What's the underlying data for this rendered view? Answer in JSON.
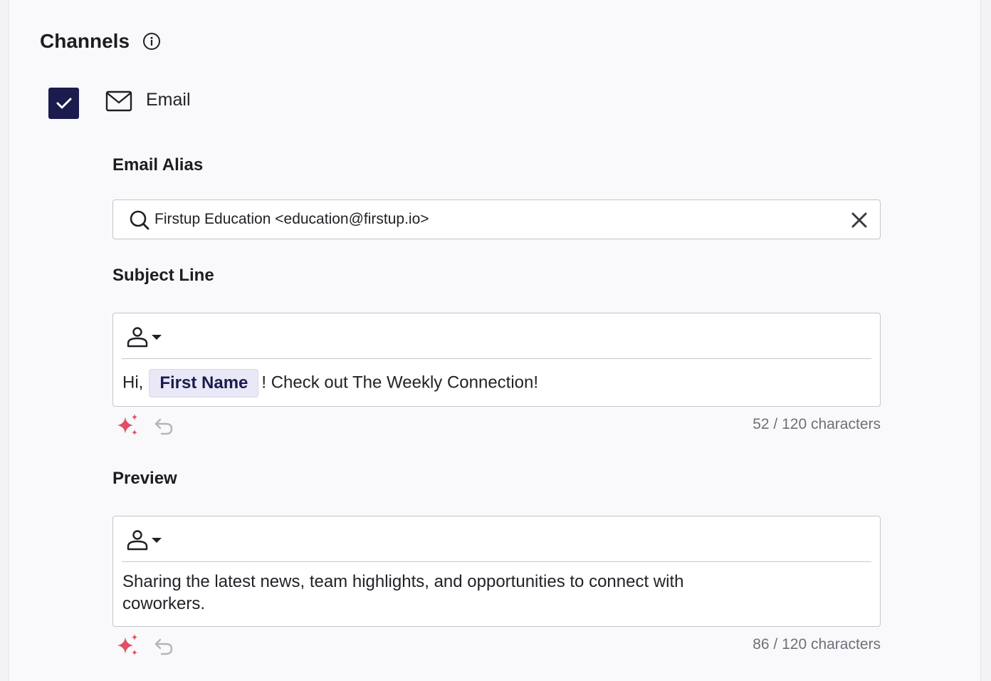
{
  "channels": {
    "title": "Channels",
    "email": {
      "label": "Email",
      "checked": true
    }
  },
  "email_alias": {
    "label": "Email Alias",
    "value": "Firstup Education <education@firstup.io>"
  },
  "subject_line": {
    "label": "Subject Line",
    "text_before": "Hi,",
    "token": "First Name",
    "text_after": "! Check out The Weekly Connection!",
    "char_count": "52 / 120 characters"
  },
  "preview": {
    "label": "Preview",
    "text": "Sharing the latest news, team highlights, and opportunities to connect with coworkers.",
    "char_count": "86 / 120 characters"
  },
  "colors": {
    "checkbox": "#1b1b4d",
    "token_bg": "#e8e8f7",
    "sparkle": "#e0505f",
    "muted_text": "#6f6f7a"
  },
  "icons": {
    "info": "info-icon",
    "checkmark": "checkmark-icon",
    "mail": "mail-icon",
    "search": "search-icon",
    "clear": "close-icon",
    "person": "person-icon",
    "caret": "caret-down-icon",
    "sparkle": "sparkle-icon",
    "undo": "undo-icon"
  }
}
